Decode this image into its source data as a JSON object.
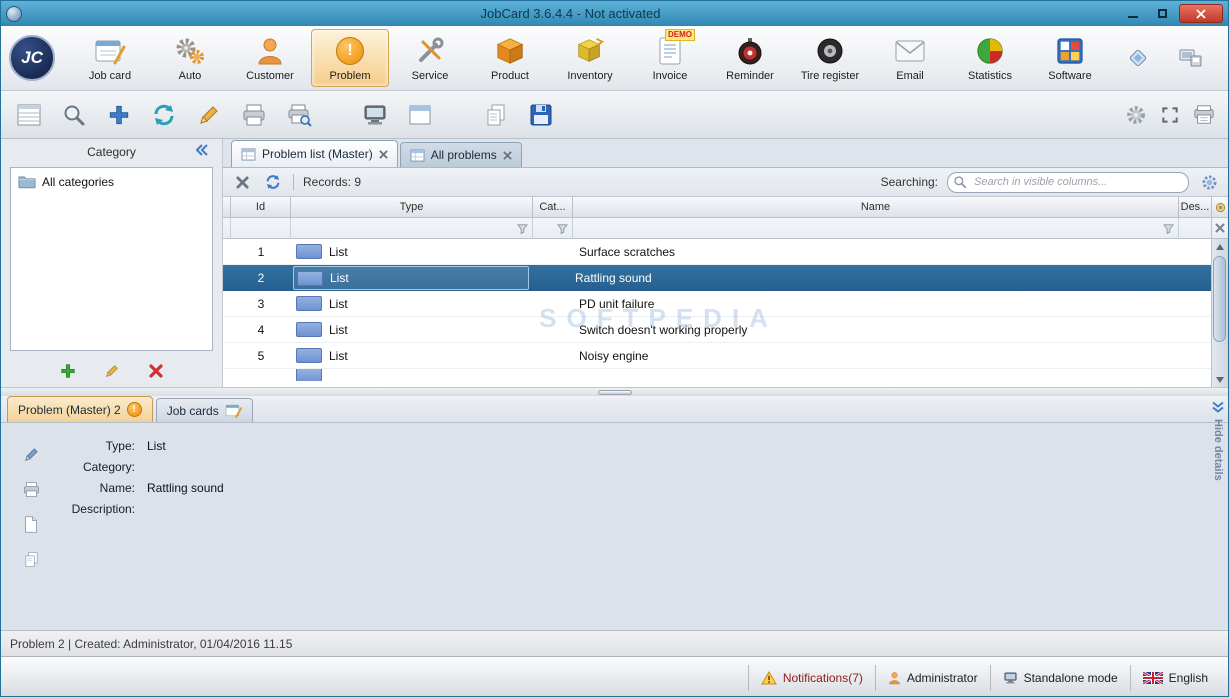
{
  "window": {
    "title": "JobCard 3.6.4.4 - Not activated",
    "logo_text": "JC"
  },
  "main_toolbar": {
    "buttons": [
      {
        "label": "Job card"
      },
      {
        "label": "Auto"
      },
      {
        "label": "Customer"
      },
      {
        "label": "Problem"
      },
      {
        "label": "Service"
      },
      {
        "label": "Product"
      },
      {
        "label": "Inventory"
      },
      {
        "label": "Invoice"
      },
      {
        "label": "Reminder"
      },
      {
        "label": "Tire register"
      },
      {
        "label": "Email"
      },
      {
        "label": "Statistics"
      },
      {
        "label": "Software"
      }
    ],
    "invoice_badge": "DEMO",
    "problem_glyph": "!"
  },
  "sidebar": {
    "title": "Category",
    "items": [
      {
        "label": "All categories"
      }
    ]
  },
  "doc_tabs": [
    {
      "label": "Problem list (Master)"
    },
    {
      "label": "All problems"
    }
  ],
  "list_toolbar": {
    "records": "Records: 9",
    "searching_label": "Searching:",
    "search_placeholder": "Search in visible columns..."
  },
  "table": {
    "columns": {
      "id": "Id",
      "type": "Type",
      "cat": "Cat...",
      "name": "Name",
      "des": "Des..."
    },
    "rows": [
      {
        "id": "1",
        "type": "List",
        "name": "Surface scratches"
      },
      {
        "id": "2",
        "type": "List",
        "name": "Rattling sound"
      },
      {
        "id": "3",
        "type": "List",
        "name": "PD unit failure"
      },
      {
        "id": "4",
        "type": "List",
        "name": "Switch doesn't working properly"
      },
      {
        "id": "5",
        "type": "List",
        "name": "Noisy engine"
      }
    ]
  },
  "details": {
    "tabs": [
      {
        "label": "Problem (Master) 2"
      },
      {
        "label": "Job cards"
      }
    ],
    "problem_tab_glyph": "!",
    "fields": [
      {
        "label": "Type:",
        "value": "List"
      },
      {
        "label": "Category:",
        "value": ""
      },
      {
        "label": "Name:",
        "value": "Rattling sound"
      },
      {
        "label": "Description:",
        "value": ""
      }
    ],
    "hide_details": "Hide details"
  },
  "status_bar": {
    "text": "Problem 2 | Created: Administrator, 01/04/2016 11.15"
  },
  "bottom_bar": {
    "notifications": "Notifications(7)",
    "user": "Administrator",
    "mode": "Standalone mode",
    "language": "English"
  },
  "watermark": "SOFTPEDIA"
}
